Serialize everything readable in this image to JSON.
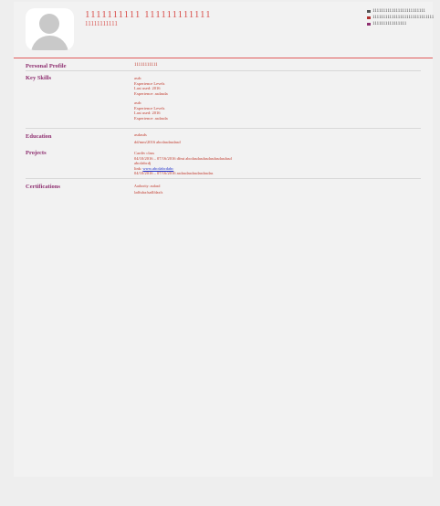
{
  "header": {
    "name": "1111111111 111111111111",
    "subtitle": "11111111111",
    "contacts": [
      {
        "icon": "envelope-icon",
        "text": "1111111111111111111111111",
        "color": "#555555"
      },
      {
        "icon": "phone-icon",
        "text": "11111111111111111111111111111",
        "color": "#b03030"
      },
      {
        "icon": "location-icon",
        "text": "1111111111111111",
        "color": "#8e2f70"
      }
    ]
  },
  "sections": {
    "personal_profile": {
      "label": "Personal Profile",
      "value": "11111111111"
    },
    "key_skills": {
      "label": "Key Skills",
      "groups": [
        {
          "name": "asdc",
          "level": "Experience Levels",
          "date": "Last used: 2016",
          "exp": "Experience: asdasda"
        },
        {
          "name": "asdc",
          "level": "Experience Levels",
          "date": "Last used: 2016",
          "exp": "Experience: asdasda"
        }
      ]
    },
    "education": {
      "label": "Education",
      "line1": "asdasds",
      "line2": "dd/mm/2016 abcdasdasdasd"
    },
    "projects": {
      "label": "Projects",
      "title": "Cardiv class",
      "line1": "04/10/2016 – 07/16/2016 dfmt abcdasdasdasdasdasdasdasd",
      "line2": "abcdabcdj",
      "link_prefix": "link:",
      "link_text": "www.abcdabcdabc",
      "line4": "04/10/2016 – 07/16/2016 asdasdasdasdasdasdas"
    },
    "certifications": {
      "label": "Certifications",
      "line1": "Authority: asdasd",
      "line2": "ladfsdaxfsadlfdaxfs"
    }
  }
}
